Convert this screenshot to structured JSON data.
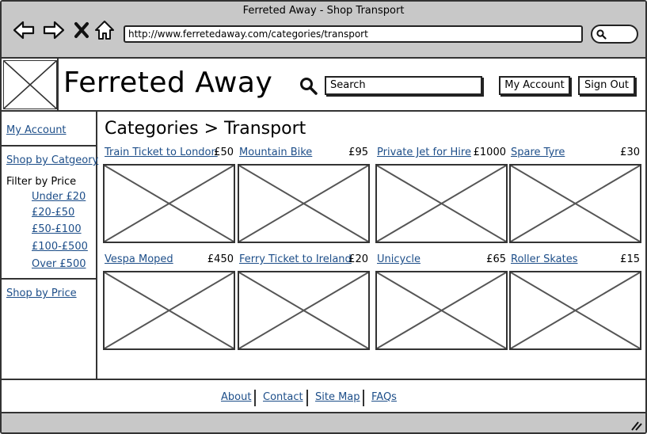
{
  "window": {
    "title": "Ferreted Away - Shop Transport"
  },
  "browser": {
    "url": "http://www.ferretedaway.com/categories/transport",
    "icons": [
      "back-arrow-icon",
      "forward-arrow-icon",
      "close-x-icon",
      "home-icon",
      "search-icon"
    ]
  },
  "header": {
    "site_title": "Ferreted Away",
    "search_placeholder": "Search",
    "my_account_label": "My Account",
    "sign_out_label": "Sign Out"
  },
  "sidebar": {
    "my_account": "My Account",
    "shop_by_category": "Shop by Catgeory",
    "filter_label": "Filter by Price",
    "filters": [
      "Under £20",
      "£20-£50",
      "£50-£100",
      "£100-£500",
      "Over £500"
    ],
    "shop_by_price": "Shop by Price"
  },
  "main": {
    "heading": "Categories > Transport",
    "products": [
      {
        "name": "Train Ticket to London",
        "price": "£50"
      },
      {
        "name": "Mountain Bike",
        "price": "£95"
      },
      {
        "name": "Private Jet for Hire",
        "price": "£1000"
      },
      {
        "name": "Spare Tyre",
        "price": "£30"
      },
      {
        "name": "Vespa Moped",
        "price": "£450"
      },
      {
        "name": "Ferry Ticket to Ireland",
        "price": "£20"
      },
      {
        "name": "Unicycle",
        "price": "£65"
      },
      {
        "name": "Roller Skates",
        "price": "£15"
      }
    ]
  },
  "footer": {
    "links": [
      "About",
      "Contact",
      "Site Map",
      "FAQs"
    ]
  }
}
